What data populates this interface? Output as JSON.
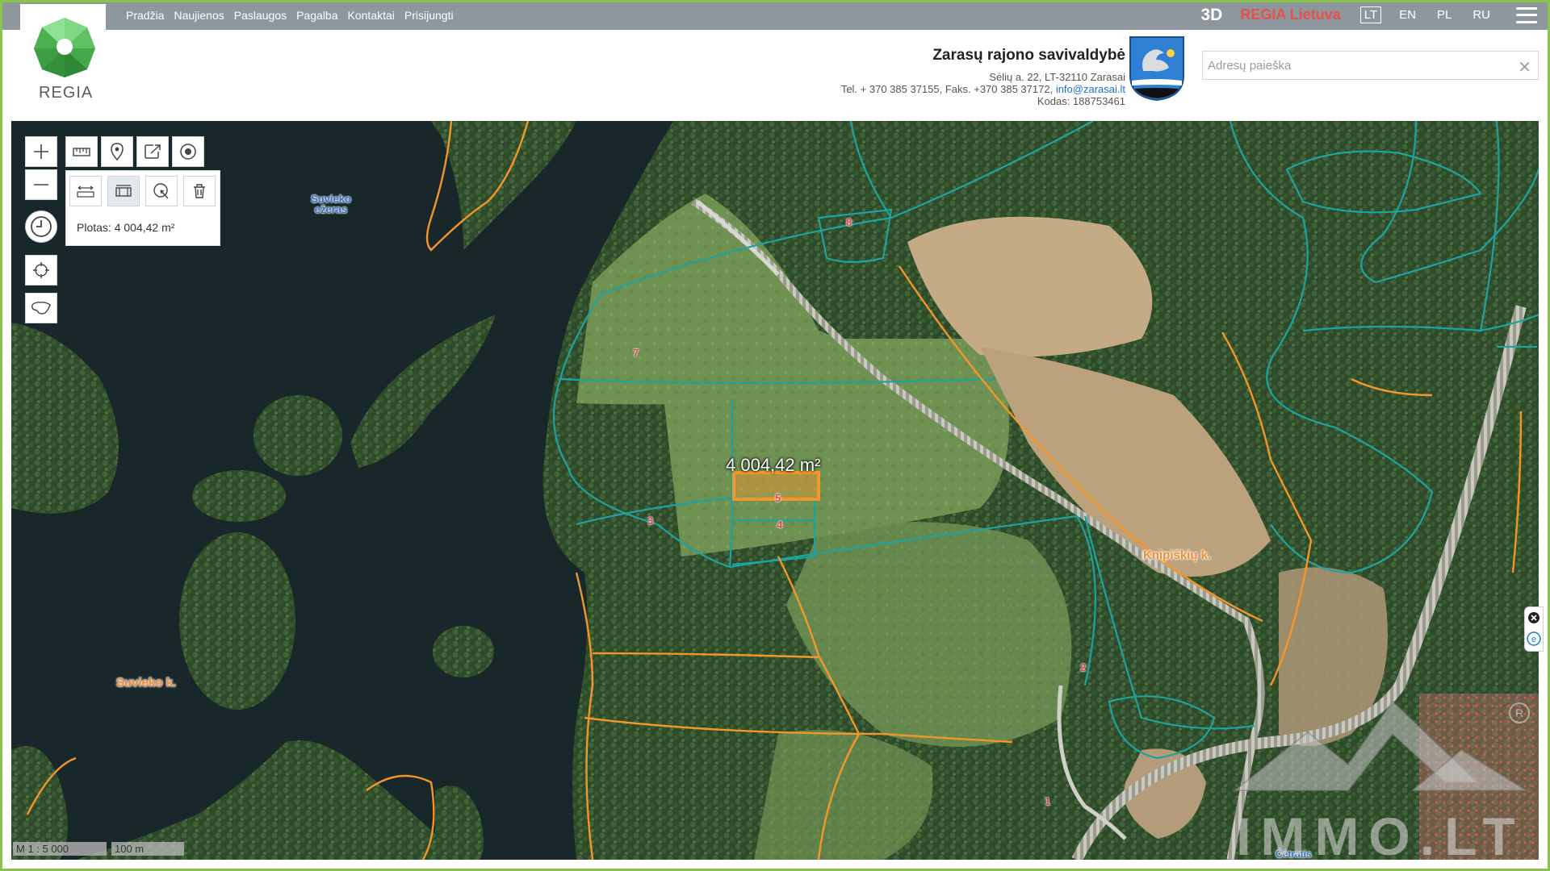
{
  "nav": {
    "items": [
      "Pradžia",
      "Naujienos",
      "Paslaugos",
      "Pagalba",
      "Kontaktai",
      "Prisijungti"
    ],
    "btn_3d": "3D",
    "regia_lietuva": "REGIA Lietuva",
    "languages": [
      "LT",
      "EN",
      "PL",
      "RU"
    ],
    "active_language": "LT"
  },
  "logo": {
    "text": "REGIA"
  },
  "municipality": {
    "name": "Zarasų rajono savivaldybė",
    "address": "Sėlių a. 22, LT-32110 Zarasai",
    "phone_prefix": "Tel. + 370 385 37155, Faks. +370 385 37172,",
    "email": "info@zarasai.lt",
    "code": "Kodas: 188753461"
  },
  "search": {
    "placeholder": "Adresų paieška",
    "value": ""
  },
  "tools": {
    "area_readout": "Plotas: 4 004,42 m²"
  },
  "map_labels": {
    "lake": "Suvieko ežeras",
    "village_suvieko": "Suvieko k.",
    "village_knipiskiu": "Knipiškių k.",
    "cemetery": "Čėtratis",
    "measurement": "4 004,42 m²",
    "parcels": [
      "8",
      "7",
      "3",
      "5",
      "4",
      "2",
      "1"
    ]
  },
  "scale": {
    "ratio": "M 1 : 5 000",
    "distance": "100 m"
  },
  "watermark": "IMMO.LT",
  "colors": {
    "parcel_teal": "#1fa3a0",
    "parcel_orange": "#f5962b",
    "regia_red": "#e8504a",
    "topbar": "#8e979e",
    "frame_green": "#8cc34a"
  }
}
